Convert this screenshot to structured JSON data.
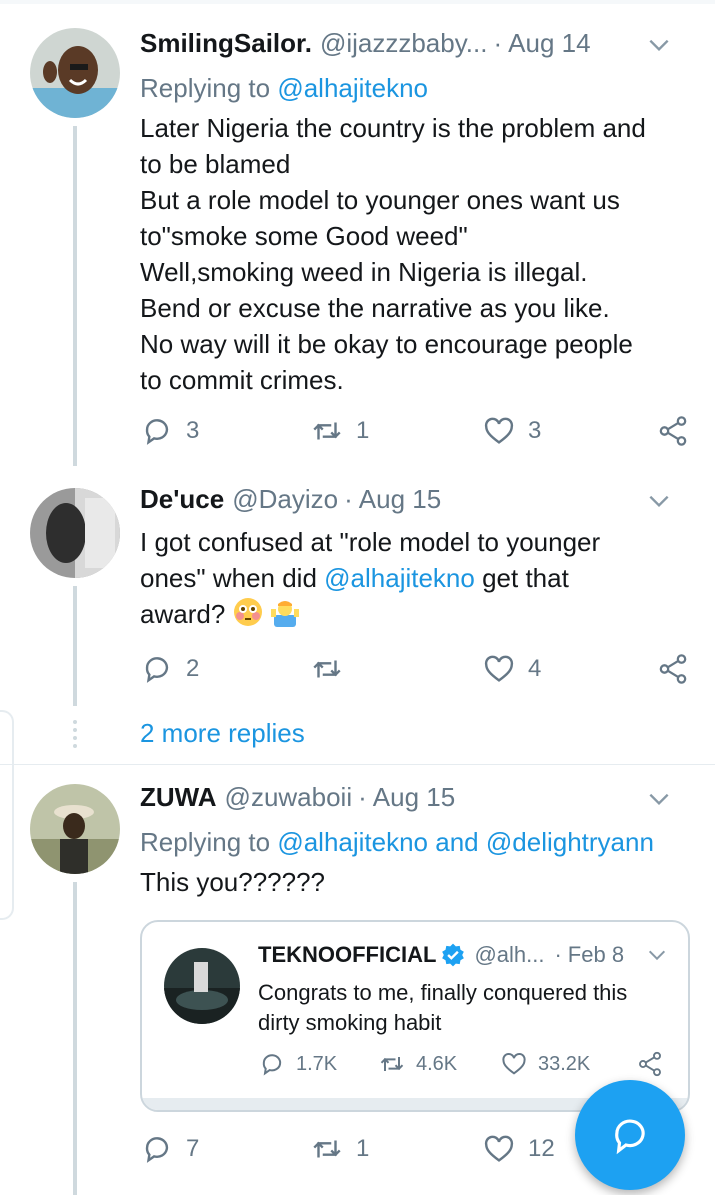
{
  "tweets": [
    {
      "name": "SmilingSailor.",
      "handle": "@ijazzzbaby...",
      "date": "Aug 14",
      "reply_label": "Replying to",
      "reply_to": "@alhajitekno",
      "lines": [
        "Later Nigeria the country is the problem and",
        "to be blamed",
        "But a role model to younger ones want us",
        "to\"smoke some Good weed\"",
        "Well,smoking weed in Nigeria is illegal.",
        "Bend or excuse the narrative as you like.",
        "No way will it be okay to encourage people",
        "to commit crimes."
      ],
      "replies": "3",
      "retweets": "1",
      "likes": "3"
    },
    {
      "name": "De'uce",
      "handle": "@Dayizo",
      "date": "Aug 15",
      "line1": "I got confused at \"role model to younger",
      "line2_a": "ones\" when did ",
      "line2_link": "@alhajitekno",
      "line2_b": " get that",
      "line3": "award?",
      "replies": "2",
      "retweets": "",
      "likes": "4"
    },
    {
      "name": "ZUWA",
      "handle": "@zuwaboii",
      "date": "Aug 15",
      "reply_label": "Replying to",
      "reply_to_1": "@alhajitekno",
      "reply_and": "and",
      "reply_to_2": "@delightryann",
      "text": "This you??????",
      "replies": "7",
      "retweets": "1",
      "likes": "12"
    }
  ],
  "more_replies": "2 more replies",
  "quoted": {
    "name": "TEKNOOFFICIAL",
    "handle": "@alh...",
    "date": "Feb 8",
    "line1": "Congrats to me, finally conquered this",
    "line2": "dirty smoking habit",
    "replies": "1.7K",
    "retweets": "4.6K",
    "likes": "33.2K"
  },
  "colors": {
    "accent": "#1da1f2",
    "link": "#1b95e0",
    "muted": "#657786",
    "thread_line": "#cfd9de"
  },
  "icons": [
    "reply-icon",
    "retweet-icon",
    "like-icon",
    "share-icon",
    "chevron-down-icon",
    "verified-icon",
    "compose-reply-icon"
  ]
}
